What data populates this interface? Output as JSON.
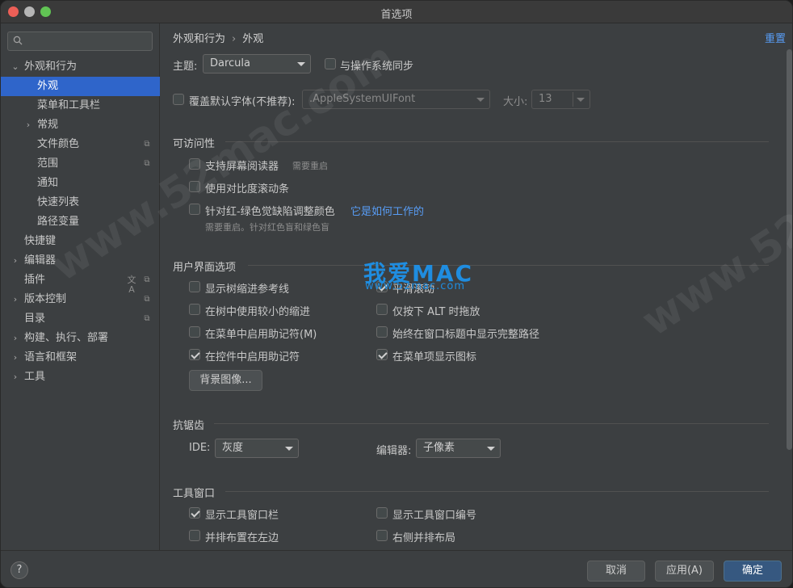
{
  "window": {
    "title": "首选项"
  },
  "sidebar": {
    "search_placeholder": "",
    "items": [
      {
        "label": "外观和行为",
        "arrow": "⌄",
        "level": 0
      },
      {
        "label": "外观",
        "selected": true,
        "level": 1
      },
      {
        "label": "菜单和工具栏",
        "level": 1
      },
      {
        "label": "常规",
        "arrow": "›",
        "level": 1
      },
      {
        "label": "文件颜色",
        "level": 1,
        "icon": "copy-icon"
      },
      {
        "label": "范围",
        "level": 1,
        "icon": "copy-icon"
      },
      {
        "label": "通知",
        "level": 1
      },
      {
        "label": "快速列表",
        "level": 1
      },
      {
        "label": "路径变量",
        "level": 1
      },
      {
        "label": "快捷键",
        "level": 0
      },
      {
        "label": "编辑器",
        "arrow": "›",
        "level": 0
      },
      {
        "label": "插件",
        "level": 0,
        "icon": "copy-icon",
        "icon2": "translate-icon"
      },
      {
        "label": "版本控制",
        "arrow": "›",
        "level": 0,
        "icon": "copy-icon"
      },
      {
        "label": "目录",
        "level": 0,
        "icon": "copy-icon"
      },
      {
        "label": "构建、执行、部署",
        "arrow": "›",
        "level": 0
      },
      {
        "label": "语言和框架",
        "arrow": "›",
        "level": 0
      },
      {
        "label": "工具",
        "arrow": "›",
        "level": 0
      }
    ]
  },
  "main": {
    "breadcrumb": [
      "外观和行为",
      "外观"
    ],
    "breadcrumb_sep": "›",
    "reset_label": "重置",
    "theme_label": "主题:",
    "theme_value": "Darcula",
    "sync_os_label": "与操作系统同步",
    "override_font_label": "覆盖默认字体(不推荐):",
    "font_value": ".AppleSystemUIFont",
    "size_label": "大小:",
    "size_value": "13",
    "accessibility": {
      "title": "可访问性",
      "screen_reader_label": "支持屏幕阅读器",
      "screen_reader_hint": "需要重启",
      "contrast_scroll_label": "使用对比度滚动条",
      "color_deficiency_label": "针对红-绿色觉缺陷调整颜色",
      "how_it_works_link": "它是如何工作的",
      "color_deficiency_hint": "需要重启。针对红色盲和绿色盲"
    },
    "ui_options": {
      "title": "用户界面选项",
      "indent_guides": "显示树缩进参考线",
      "smooth_scroll": "平滑滚动",
      "smaller_indent": "在树中使用较小的缩进",
      "alt_drag": "仅按下 ALT 时拖放",
      "menu_mnemonics": "在菜单中启用助记符(M)",
      "full_path_title": "始终在窗口标题中显示完整路径",
      "control_mnemonics": "在控件中启用助记符",
      "menu_icons": "在菜单项显示图标",
      "background_image_button": "背景图像..."
    },
    "antialiasing": {
      "title": "抗锯齿",
      "ide_label": "IDE:",
      "ide_value": "灰度",
      "editor_label": "编辑器:",
      "editor_value": "子像素"
    },
    "tool_windows": {
      "title": "工具窗口",
      "show_stripes": "显示工具窗口栏",
      "show_numbers": "显示工具窗口编号",
      "side_by_side_left": "并排布置在左边",
      "side_by_side_right": "右侧并排布局"
    }
  },
  "footer": {
    "help_label": "?",
    "cancel_label": "取消",
    "apply_label": "应用(A)",
    "ok_label": "确定"
  },
  "overlay": {
    "watermark": "www.52mac.com",
    "brand_title": "我爱MAC",
    "brand_url": "www.52mac.com"
  },
  "colors": {
    "accent": "#2f65ca",
    "link": "#589df6",
    "primary_button": "#365880"
  }
}
